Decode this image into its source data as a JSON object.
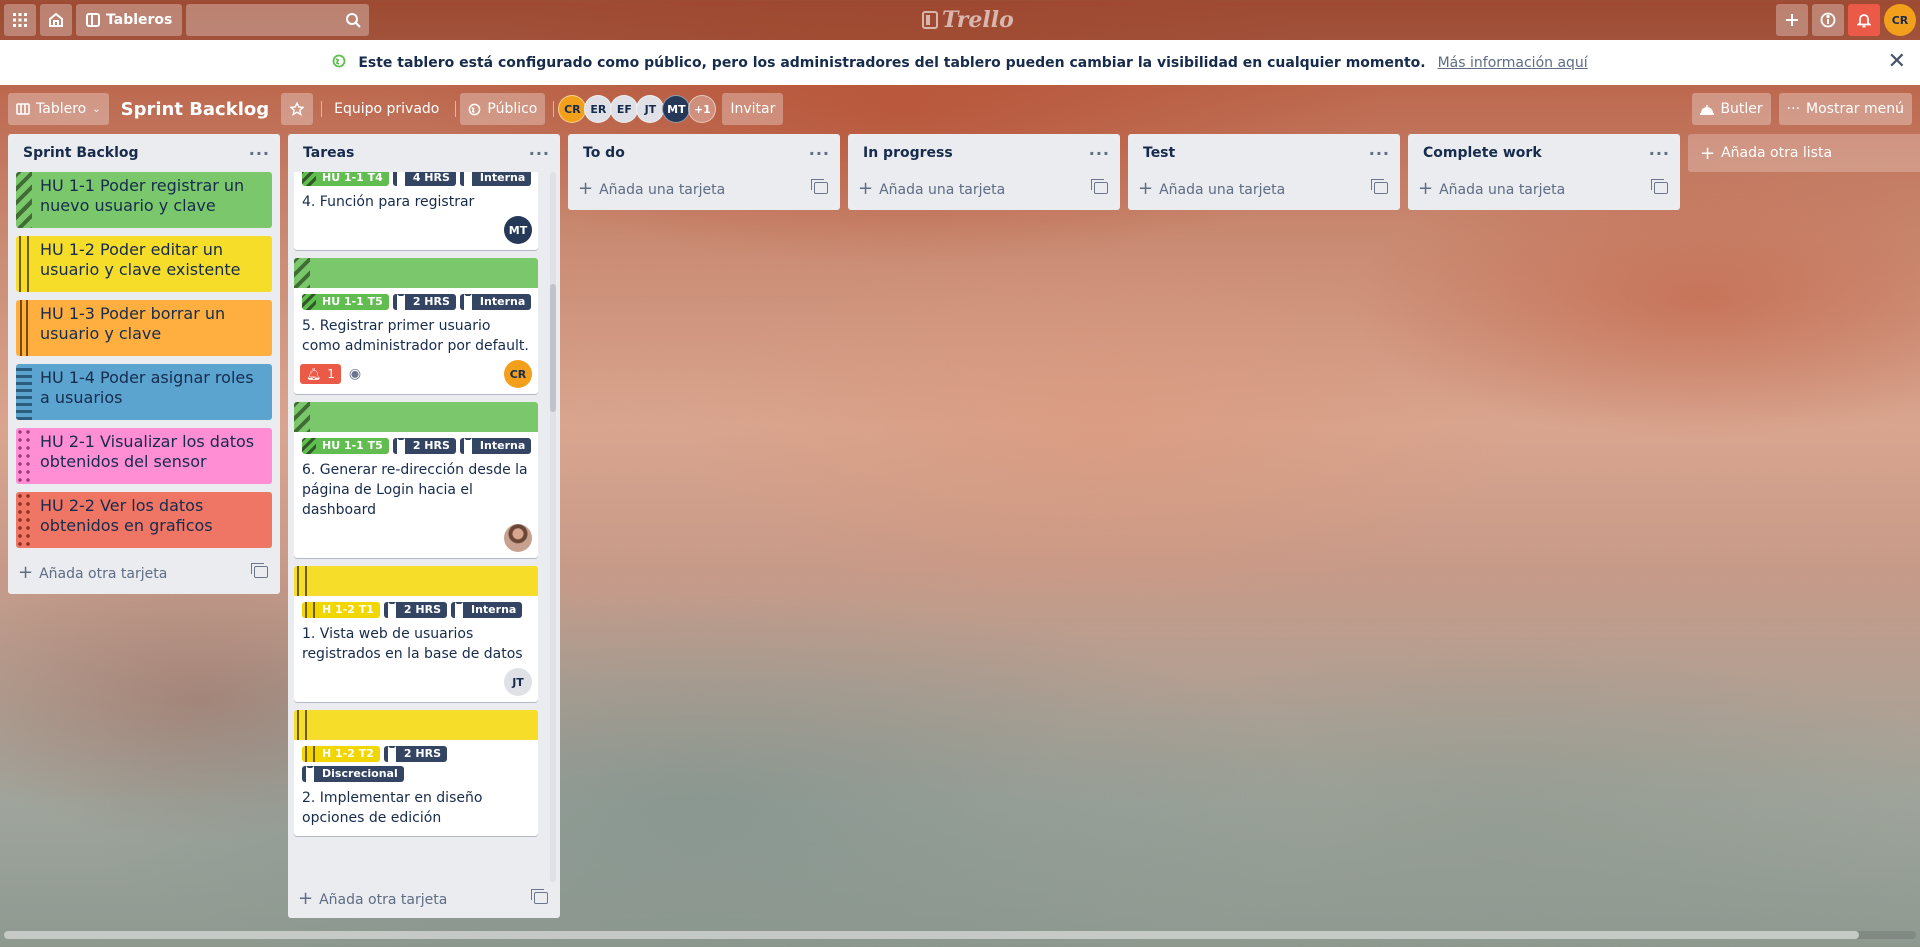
{
  "topbar": {
    "boards_label": "Tableros",
    "search_placeholder": "",
    "logo": "Trello",
    "user_initials": "CR"
  },
  "banner": {
    "message": "Este tablero está configurado como público, pero los administradores del tablero pueden cambiar la visibilidad en cualquier momento.",
    "link": "Más información aquí"
  },
  "board_header": {
    "view_label": "Tablero",
    "title": "Sprint Backlog",
    "team_label": "Equipo privado",
    "visibility_label": "Público",
    "members": [
      "CR",
      "ER",
      "EF",
      "JT",
      "MT"
    ],
    "more_members": "+1",
    "invite_label": "Invitar",
    "butler_label": "Butler",
    "menu_label": "Mostrar menú"
  },
  "colors": {
    "green": "#7bc86c",
    "yellow": "#f5dd29",
    "orange": "#ffaf3f",
    "blue": "#5ba4cf",
    "pink": "#ff8ed4",
    "red": "#ef7564",
    "notification": "#eb5a46"
  },
  "lists": {
    "sprint_backlog": {
      "title": "Sprint Backlog",
      "cards": [
        {
          "text": "HU 1-1 Poder registrar un nuevo usuario y clave",
          "color": "green"
        },
        {
          "text": "HU 1-2 Poder editar un usuario y clave existente",
          "color": "yellow"
        },
        {
          "text": "HU 1-3 Poder borrar un usuario y clave",
          "color": "orange"
        },
        {
          "text": "HU 1-4 Poder asignar roles a usuarios",
          "color": "blue"
        },
        {
          "text": "HU 2-1 Visualizar los datos obtenidos del sensor",
          "color": "pink"
        },
        {
          "text": "HU 2-2 Ver los datos obtenidos en graficos",
          "color": "red"
        }
      ],
      "add_label": "Añada otra tarjeta"
    },
    "tareas": {
      "title": "Tareas",
      "cards": [
        {
          "labels": [
            "HU 1-1 T4",
            "4 HRS",
            "Interna"
          ],
          "title": "4. Función para registrar",
          "member": "MT"
        },
        {
          "labels": [
            "HU 1-1 T5",
            "2 HRS",
            "Interna"
          ],
          "title": "5. Registrar primer usuario como administrador por default.",
          "notifications": "1",
          "member": "CR"
        },
        {
          "labels": [
            "HU 1-1 T5",
            "2 HRS",
            "Interna"
          ],
          "title": "6. Generar re-dirección desde la página de Login hacia el dashboard"
        },
        {
          "labels": [
            "H 1-2 T1",
            "2 HRS",
            "Interna"
          ],
          "title": "1. Vista web de usuarios registrados en la base de datos",
          "member": "JT"
        },
        {
          "labels": [
            "H 1-2 T2",
            "2 HRS",
            "Discrecional"
          ],
          "title": "2. Implementar en diseño opciones de edición"
        }
      ],
      "add_label": "Añada otra tarjeta"
    },
    "todo": {
      "title": "To do",
      "add_label": "Añada una tarjeta"
    },
    "in_progress": {
      "title": "In progress",
      "add_label": "Añada una tarjeta"
    },
    "test": {
      "title": "Test",
      "add_label": "Añada una tarjeta"
    },
    "complete": {
      "title": "Complete work",
      "add_label": "Añada una tarjeta"
    }
  },
  "add_list_label": "Añada otra lista"
}
